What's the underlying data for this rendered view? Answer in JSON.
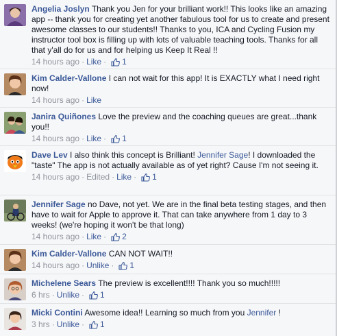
{
  "comments": [
    {
      "author": "Angelia Joslyn",
      "text": "Thank you Jen for your brilliant work!! This looks like an amazing app -- thank you for creating yet another fabulous tool for us to create and present awesome classes to our students!! Thanks to you, ICA and Cycling Fusion my instructor tool box is filling up with lots of valuable teaching tools. Thanks for all that y'all do for us and for helping us Keep It Real !!",
      "time": "14 hours ago",
      "action": "Like",
      "likes": "1",
      "avatar_color": "#7a5a9a"
    },
    {
      "author": "Kim Calder-Vallone",
      "text": "I can not wait for this app! It is EXACTLY what I need right now!",
      "time": "14 hours ago",
      "action": "Like",
      "likes": "",
      "avatar_color": "#9a6b4b"
    },
    {
      "author": "Janira Quiñones",
      "text": "Love the preview and the coaching queues are great...thank you!!",
      "time": "14 hours ago",
      "action": "Like",
      "likes": "1",
      "avatar_color": "#6b7b5a"
    },
    {
      "author": "Dave Lev",
      "text_before": "I also think this concept is Brilliant! ",
      "mention": "Jennifer Sage",
      "text_after": "! I downloaded the \"taste\" The app is not actually available as of yet right? Cause I'm not seeing it.",
      "time": "14 hours ago",
      "edited": "Edited",
      "action": "Like",
      "likes": "1",
      "avatar_color": "#f08020"
    },
    {
      "author": "Jennifer Sage",
      "text": "no Dave, not yet. We are in the final beta testing stages, and then have to wait for Apple to approve it. That can take anywhere from 1 day to 3 weeks! (we're hoping it won't be that long)",
      "time": "14 hours ago",
      "action": "Like",
      "likes": "2",
      "avatar_color": "#5a6a4a"
    },
    {
      "author": "Kim Calder-Vallone",
      "text": "CAN NOT WAIT!!",
      "time": "14 hours ago",
      "action": "Unlike",
      "likes": "1",
      "avatar_color": "#9a6b4b"
    },
    {
      "author": "Michelene Sears",
      "text": "The preview is excellent!!!! Thank you so much!!!!!",
      "time": "6 hrs",
      "action": "Unlike",
      "likes": "1",
      "avatar_color": "#c08060"
    },
    {
      "author": "Micki Contini",
      "text_before": "Awesome idea!! Learning so much from you ",
      "mention": "Jennifer",
      "text_after": " !",
      "time": "3 hrs",
      "action": "Unlike",
      "likes": "1",
      "avatar_color": "#8a7060"
    }
  ]
}
